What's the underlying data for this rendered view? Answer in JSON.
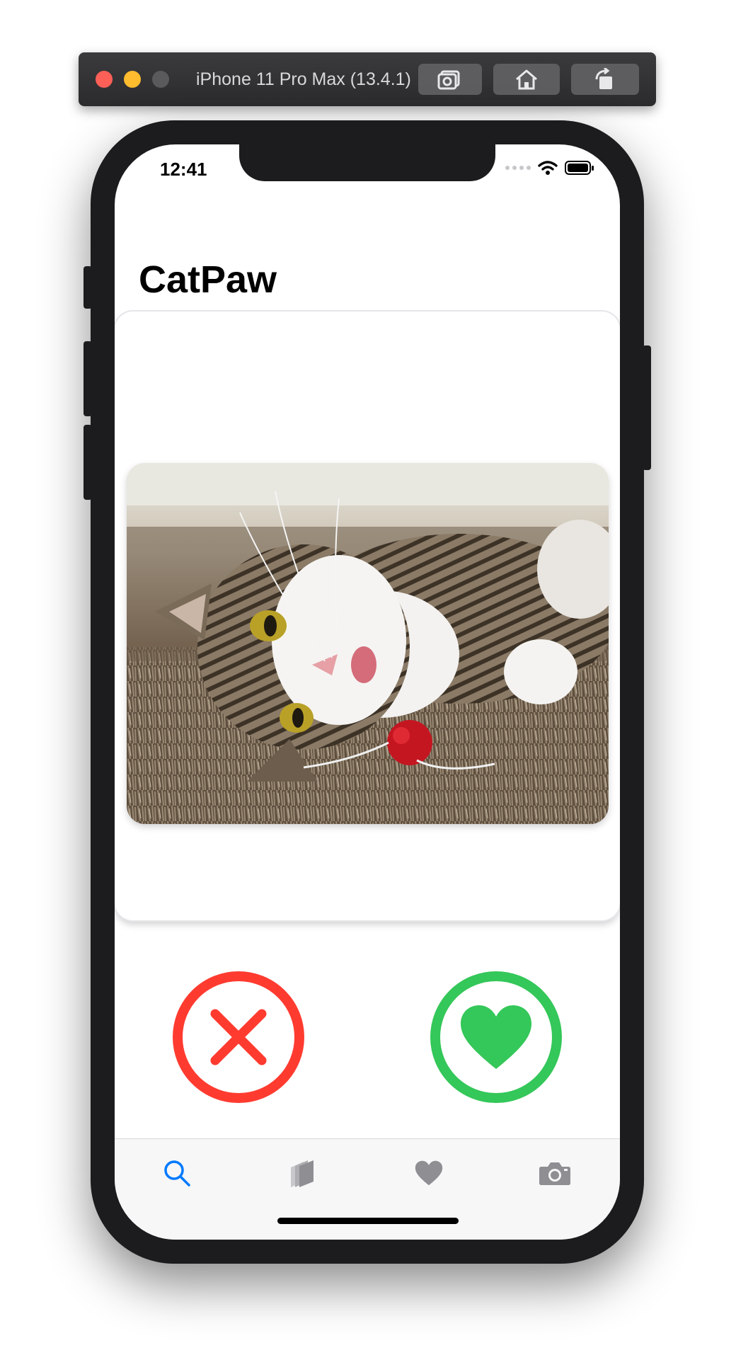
{
  "simulator": {
    "device_title": "iPhone 11 Pro Max (13.4.1)",
    "buttons": [
      "screenshot-icon",
      "home-icon",
      "rotate-icon"
    ]
  },
  "status_bar": {
    "time": "12:41",
    "icons": [
      "signal-icon",
      "wifi-icon",
      "battery-icon"
    ]
  },
  "app": {
    "title": "CatPaw"
  },
  "card": {
    "image": "cat-photo"
  },
  "actions": {
    "reject_icon": "x-icon",
    "like_icon": "heart-icon",
    "reject_color": "#ff3b30",
    "like_color": "#34c759"
  },
  "tabbar": {
    "tabs": [
      {
        "icon": "search-icon",
        "active": true
      },
      {
        "icon": "stack-icon",
        "active": false
      },
      {
        "icon": "heart-icon",
        "active": false
      },
      {
        "icon": "camera-icon",
        "active": false
      }
    ],
    "active_color": "#007aff",
    "inactive_color": "#8e8e93"
  }
}
